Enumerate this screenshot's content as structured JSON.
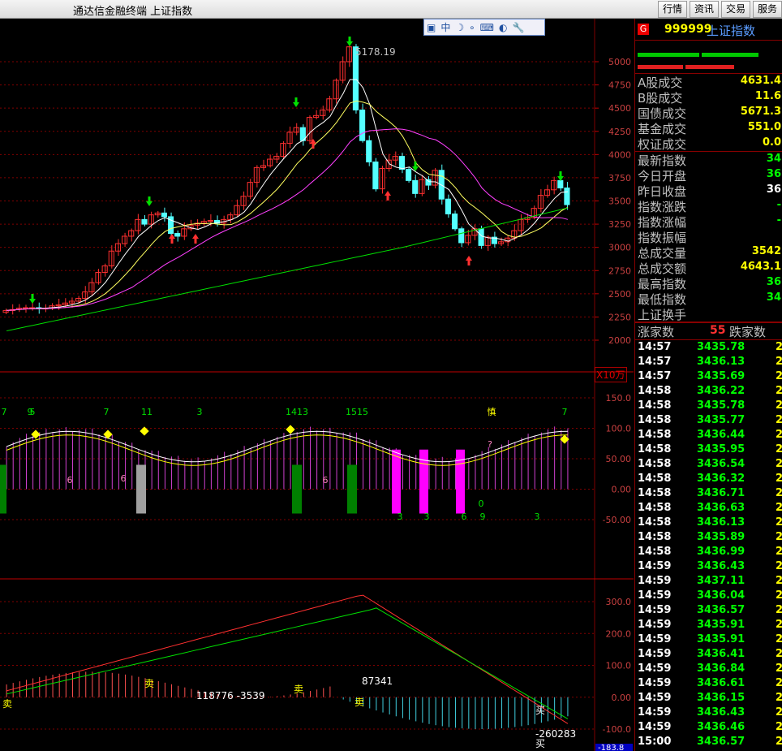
{
  "window": {
    "title": "通达信金融终端   上证指数"
  },
  "top_buttons": [
    "行情",
    "资讯",
    "交易",
    "服务"
  ],
  "float_toolbar": {
    "buttons": [
      "中",
      "☽",
      "∘",
      "⌨",
      "◐",
      "🔧"
    ]
  },
  "main_chart": {
    "high_label": "5178.19",
    "y_ticks": [
      "5000",
      "4750",
      "4500",
      "4250",
      "4000",
      "3750",
      "3500",
      "3250",
      "3000",
      "2750",
      "2500",
      "2250",
      "2000"
    ]
  },
  "indicator": {
    "unit": "X10万",
    "y_ticks": [
      "150.0",
      "100.0",
      "50.00",
      "0.00",
      "-50.00"
    ],
    "labels": [
      "7",
      "9",
      "5",
      "7",
      "11",
      "3",
      "1413",
      "1515",
      "慎",
      "7",
      "?",
      "6",
      "6",
      "6",
      "3",
      "3",
      "6",
      "9",
      "0",
      "3"
    ]
  },
  "macd": {
    "y_ticks": [
      "300.0",
      "200.0",
      "100.0",
      "0.00",
      "-100.0"
    ],
    "labels": [
      "卖",
      "118776 -3539",
      "卖",
      "87341",
      "卖",
      "卖",
      "买",
      "-260283",
      "买"
    ],
    "bottom_value": "-183.8"
  },
  "right_panel": {
    "badge": "G",
    "code": "999999",
    "name": "上证指数",
    "stats": [
      {
        "label": "A股成交",
        "value": "4631.4",
        "color": "#ffff00"
      },
      {
        "label": "B股成交",
        "value": "11.6",
        "color": "#ffff00"
      },
      {
        "label": "国债成交",
        "value": "5671.3",
        "color": "#ffff00"
      },
      {
        "label": "基金成交",
        "value": "551.0",
        "color": "#ffff00"
      },
      {
        "label": "权证成交",
        "value": "0.0",
        "color": "#ffff00"
      },
      {
        "label": "最新指数",
        "value": "34",
        "color": "#00ff00"
      },
      {
        "label": "今日开盘",
        "value": "36",
        "color": "#00ff00"
      },
      {
        "label": "昨日收盘",
        "value": "36",
        "color": "#ffffff"
      },
      {
        "label": "指数涨跌",
        "value": "-",
        "color": "#00ff00"
      },
      {
        "label": "指数涨幅",
        "value": "-",
        "color": "#00ff00"
      },
      {
        "label": "指数振幅",
        "value": "",
        "color": "#ffffff"
      },
      {
        "label": "总成交量",
        "value": "3542",
        "color": "#ffff00"
      },
      {
        "label": "总成交额",
        "value": "4643.1",
        "color": "#ffff00"
      },
      {
        "label": "最高指数",
        "value": "36",
        "color": "#00ff00"
      },
      {
        "label": "最低指数",
        "value": "34",
        "color": "#00ff00"
      },
      {
        "label": "上证换手",
        "value": "",
        "color": "#ffffff"
      }
    ],
    "rise_label": "涨家数",
    "rise_value": "55",
    "fall_label": "跌家数",
    "ticks": [
      {
        "time": "14:57",
        "price": "3435.78",
        "vol": "2"
      },
      {
        "time": "14:57",
        "price": "3436.13",
        "vol": "2"
      },
      {
        "time": "14:57",
        "price": "3435.69",
        "vol": "2"
      },
      {
        "time": "14:58",
        "price": "3436.22",
        "vol": "2"
      },
      {
        "time": "14:58",
        "price": "3435.78",
        "vol": "2"
      },
      {
        "time": "14:58",
        "price": "3435.77",
        "vol": "2"
      },
      {
        "time": "14:58",
        "price": "3436.44",
        "vol": "2"
      },
      {
        "time": "14:58",
        "price": "3435.95",
        "vol": "2"
      },
      {
        "time": "14:58",
        "price": "3436.54",
        "vol": "2"
      },
      {
        "time": "14:58",
        "price": "3436.32",
        "vol": "2"
      },
      {
        "time": "14:58",
        "price": "3436.71",
        "vol": "2"
      },
      {
        "time": "14:58",
        "price": "3436.63",
        "vol": "2"
      },
      {
        "time": "14:58",
        "price": "3436.13",
        "vol": "2"
      },
      {
        "time": "14:58",
        "price": "3435.89",
        "vol": "2"
      },
      {
        "time": "14:58",
        "price": "3436.99",
        "vol": "2"
      },
      {
        "time": "14:59",
        "price": "3436.43",
        "vol": "2"
      },
      {
        "time": "14:59",
        "price": "3437.11",
        "vol": "2"
      },
      {
        "time": "14:59",
        "price": "3436.04",
        "vol": "2"
      },
      {
        "time": "14:59",
        "price": "3436.57",
        "vol": "2"
      },
      {
        "time": "14:59",
        "price": "3435.91",
        "vol": "2"
      },
      {
        "time": "14:59",
        "price": "3435.91",
        "vol": "2"
      },
      {
        "time": "14:59",
        "price": "3436.41",
        "vol": "2"
      },
      {
        "time": "14:59",
        "price": "3436.84",
        "vol": "2"
      },
      {
        "time": "14:59",
        "price": "3436.61",
        "vol": "2"
      },
      {
        "time": "14:59",
        "price": "3436.15",
        "vol": "2"
      },
      {
        "time": "14:59",
        "price": "3436.43",
        "vol": "2"
      },
      {
        "time": "14:59",
        "price": "3436.46",
        "vol": "2"
      },
      {
        "time": "15:00",
        "price": "3436.57",
        "vol": "2"
      }
    ]
  },
  "colors": {
    "up": "#ff3030",
    "down": "#54ffff",
    "ma5": "#ffffff",
    "ma10": "#ffff60",
    "ma20": "#ff40ff",
    "ma60": "#00e000",
    "grid": "#800000"
  }
}
